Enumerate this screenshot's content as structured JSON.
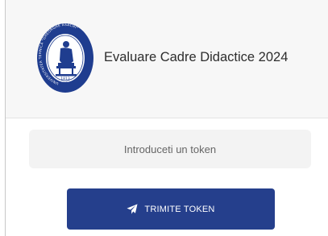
{
  "header": {
    "title": "Evaluare Cadre Didactice 2024",
    "logo": {
      "icon": "university-seal-icon",
      "ring_text": "UNIVERSITATEA TEHNICĂ \"GHEORGHE ASACHI\"",
      "year_founded": "1813",
      "location": "IAȘI"
    }
  },
  "token_form": {
    "input_value": "",
    "input_placeholder": "Introduceti un token",
    "submit_label": "TRIMITE TOKEN",
    "submit_icon": "paper-plane-icon"
  },
  "colors": {
    "primary": "#253f8c",
    "seal_blue": "#1f3d8f",
    "header_bg": "#f7f7f7",
    "input_bg": "#f3f3f3"
  }
}
